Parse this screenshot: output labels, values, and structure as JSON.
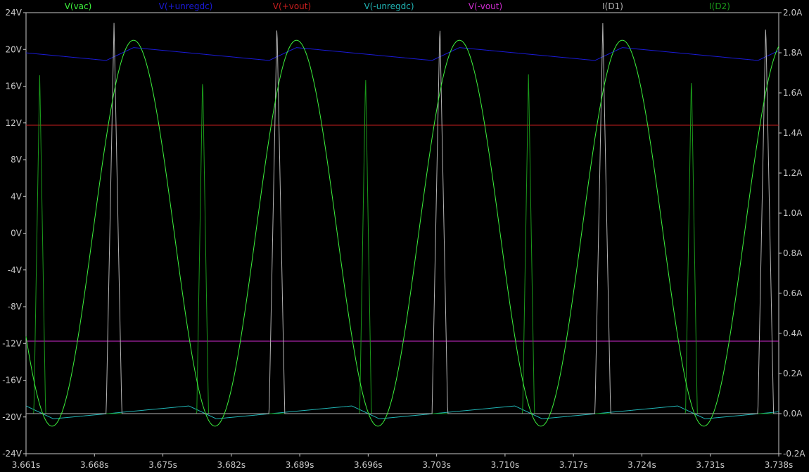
{
  "chart_data": {
    "type": "line",
    "title": "",
    "xlabel": "",
    "ylabel": "",
    "x_ticks": [
      "3.661s",
      "3.668s",
      "3.675s",
      "3.682s",
      "3.689s",
      "3.696s",
      "3.703s",
      "3.710s",
      "3.717s",
      "3.724s",
      "3.731s",
      "3.738s"
    ],
    "xlim": [
      3.661,
      3.738
    ],
    "y_left_ticks": [
      "24V",
      "20V",
      "16V",
      "12V",
      "8V",
      "4V",
      "0V",
      "-4V",
      "-8V",
      "-12V",
      "-16V",
      "-20V",
      "-24V"
    ],
    "ylim_left": [
      -24,
      24
    ],
    "y_right_ticks": [
      "2.0A",
      "1.8A",
      "1.6A",
      "1.4A",
      "1.2A",
      "1.0A",
      "0.8A",
      "0.6A",
      "0.4A",
      "0.2A",
      "0.0A",
      "-0.2A"
    ],
    "ylim_right": [
      -0.2,
      2.0
    ],
    "grid": false,
    "legend_position": "top",
    "background": "#000000",
    "series": [
      {
        "name": "V(vac)",
        "axis": "left",
        "color": "#3cf03c",
        "kind": "sine",
        "amplitude": 21.0,
        "frequency": 60,
        "phase_peak": 3.672
      },
      {
        "name": "V(+unregdc)",
        "axis": "left",
        "color": "#1a1ad6",
        "kind": "ripple",
        "peak": 20.2,
        "trough": 18.8,
        "period": 0.0166667,
        "phase_peak": 3.672
      },
      {
        "name": "V(+vout)",
        "axis": "left",
        "color": "#c81e1e",
        "kind": "const",
        "value": 11.75
      },
      {
        "name": "V(-unregdc)",
        "axis": "left",
        "color": "#20b4b4",
        "kind": "ripple",
        "peak": -20.2,
        "trough": -18.8,
        "period": 0.0166667,
        "phase_peak": 3.6638
      },
      {
        "name": "V(-vout)",
        "axis": "left",
        "color": "#d02cd0",
        "kind": "const",
        "value": -11.75
      },
      {
        "name": "I(D1)",
        "axis": "right",
        "color": "#b4b4b4",
        "kind": "pulses",
        "peak": 1.95,
        "width": 0.0016,
        "period": 0.0166667,
        "first_peak": 3.67
      },
      {
        "name": "I(D2)",
        "axis": "right",
        "color": "#1a9a1a",
        "kind": "pulses",
        "peak": 1.7,
        "width": 0.0012,
        "period": 0.0166667,
        "first_peak": 3.6624
      }
    ]
  }
}
